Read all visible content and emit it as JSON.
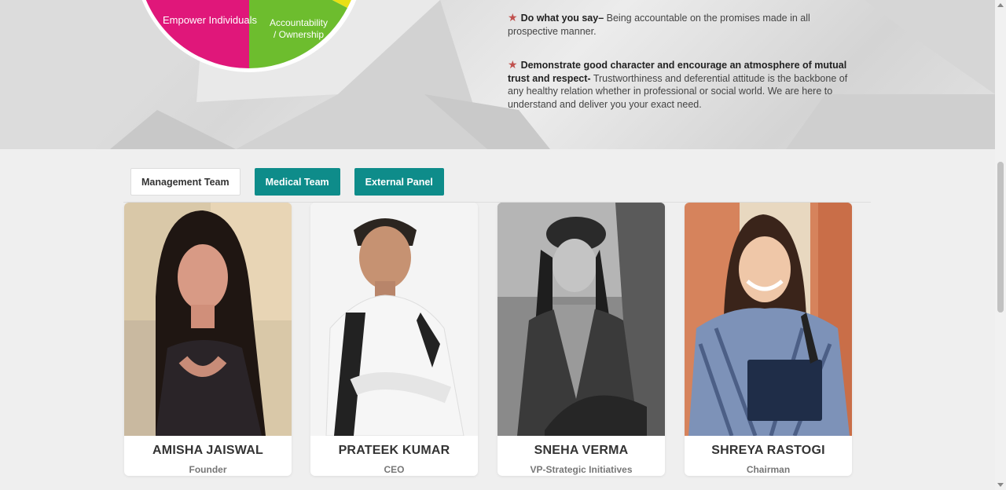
{
  "wheel": {
    "segments": [
      {
        "label": "Empower Individuals",
        "color": "#e0177a"
      },
      {
        "label_line1": "Accountability",
        "label_line2": "/ Ownership",
        "color": "#6dbd2e"
      },
      {
        "label": "",
        "color": "#e8e014"
      }
    ]
  },
  "values": [
    {
      "title": "Do what you say–",
      "text": " Being accountable on the promises made in all prospective manner."
    },
    {
      "title": "Demonstrate good character and encourage an atmosphere of mutual trust and respect-",
      "text": " Trustworthiness and deferential attitude is the backbone of any healthy relation whether in professional or social world. We are here to understand and deliver you your exact need."
    }
  ],
  "tabs": [
    {
      "label": "Management Team"
    },
    {
      "label": "Medical Team"
    },
    {
      "label": "External Panel"
    }
  ],
  "team": [
    {
      "name": "AMISHA JAISWAL",
      "role": "Founder"
    },
    {
      "name": "PRATEEK KUMAR",
      "role": "CEO"
    },
    {
      "name": "SNEHA VERMA",
      "role": "VP-Strategic Initiatives"
    },
    {
      "name": "SHREYA RASTOGI",
      "role": "Chairman"
    }
  ],
  "colors": {
    "accent": "#0e8c8a",
    "star": "#c0504d"
  }
}
